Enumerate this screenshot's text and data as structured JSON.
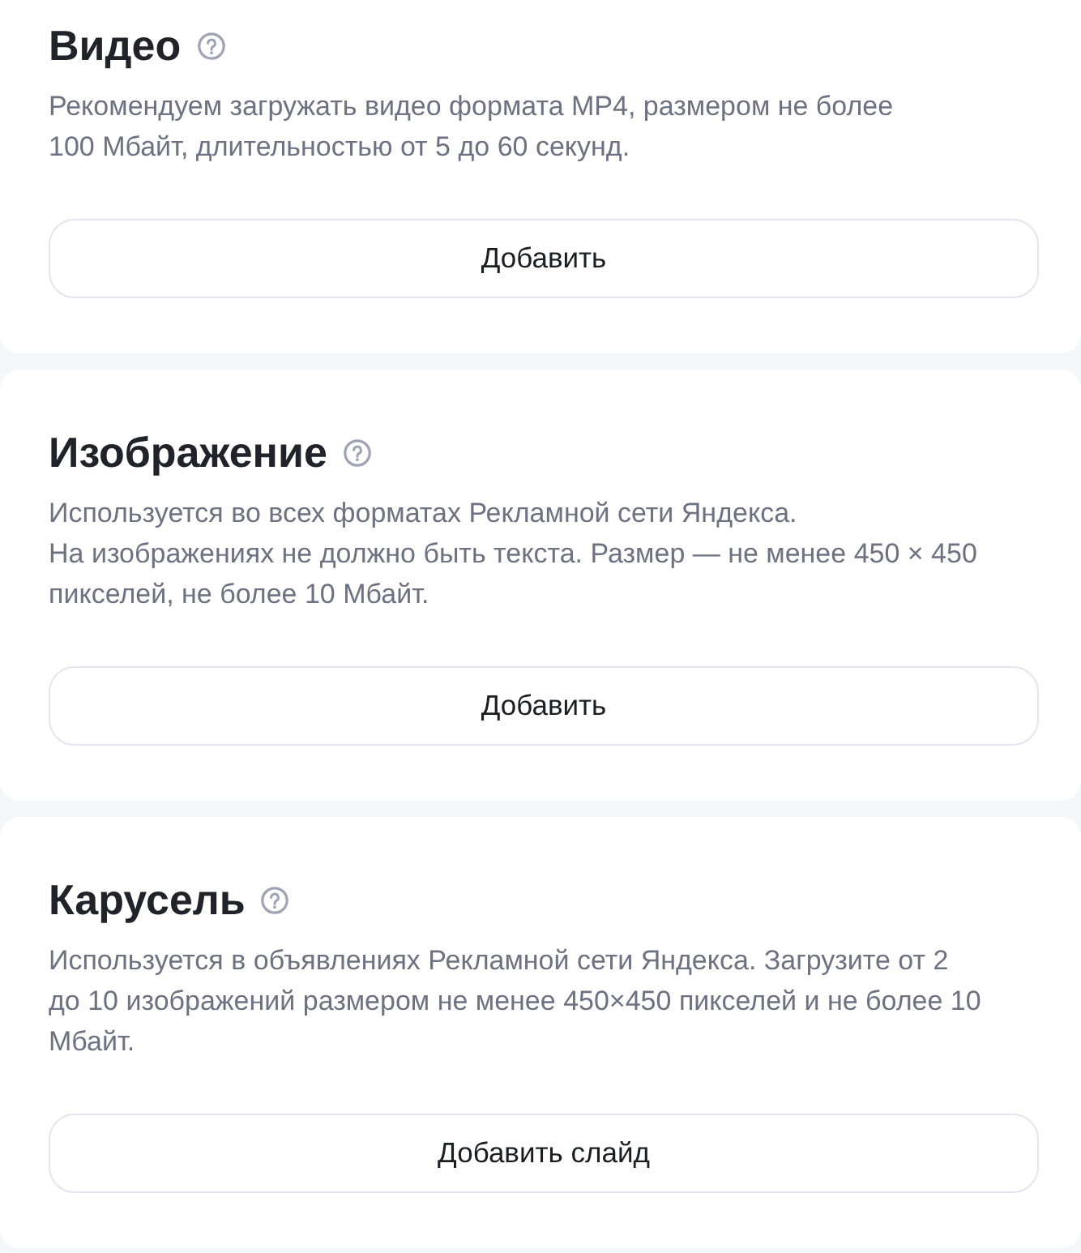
{
  "sections": [
    {
      "title": "Видео",
      "description": "Рекомендуем загружать видео формата MP4, размером не более\n100 Мбайт, длительностью от 5 до 60 секунд.",
      "button": "Добавить"
    },
    {
      "title": "Изображение",
      "description": "Используется во всех форматах Рекламной сети Яндекса.\nНа изображениях не должно быть текста. Размер — не менее 450 × 450\nпикселей, не более 10 Мбайт.",
      "button": "Добавить"
    },
    {
      "title": "Карусель",
      "description": "Используется в объявлениях Рекламной сети Яндекса. Загрузите от 2\nдо 10 изображений размером не менее 450×450 пикселей и не более 10\nМбайт.",
      "button": "Добавить слайд"
    }
  ]
}
